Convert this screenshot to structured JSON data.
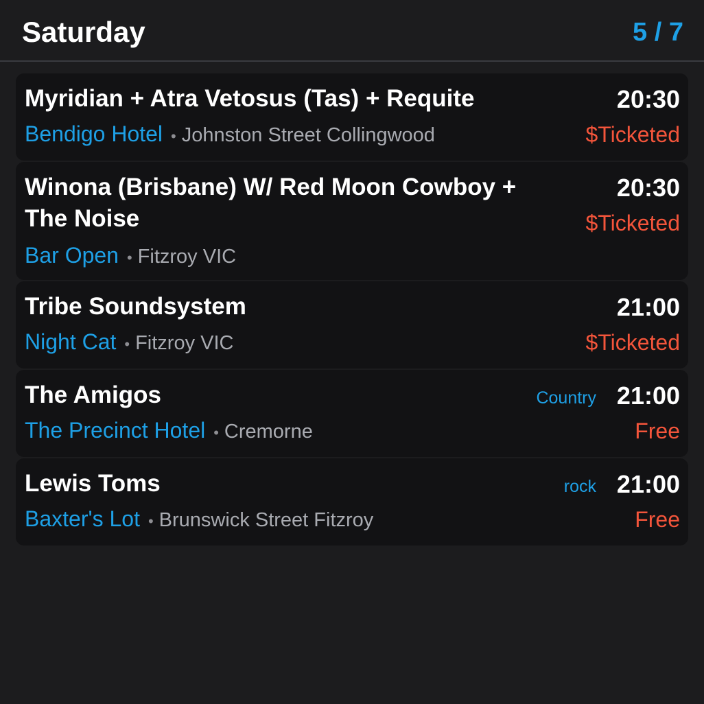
{
  "header": {
    "title": "Saturday",
    "page_indicator": "5 / 7"
  },
  "events": [
    {
      "title": "Myridian + Atra Vetosus (Tas) + Requite",
      "venue": "Bendigo Hotel",
      "separator": "•",
      "location": "Johnston Street Collingwood",
      "time": "20:30",
      "price": "$Ticketed",
      "genre": ""
    },
    {
      "title": "Winona (Brisbane) W/ Red Moon Cowboy + The Noise",
      "venue": "Bar Open",
      "separator": "•",
      "location": "Fitzroy VIC",
      "time": "20:30",
      "price": "$Ticketed",
      "genre": ""
    },
    {
      "title": "Tribe Soundsystem",
      "venue": "Night Cat",
      "separator": "•",
      "location": "Fitzroy VIC",
      "time": "21:00",
      "price": "$Ticketed",
      "genre": ""
    },
    {
      "title": "The Amigos",
      "venue": "The Precinct Hotel",
      "separator": "•",
      "location": "Cremorne",
      "time": "21:00",
      "price": "Free",
      "genre": "Country"
    },
    {
      "title": "Lewis Toms",
      "venue": "Baxter's Lot",
      "separator": "•",
      "location": "Brunswick Street Fitzroy",
      "time": "21:00",
      "price": "Free",
      "genre": "rock"
    }
  ],
  "colors": {
    "background": "#1c1c1e",
    "card": "#121214",
    "accent": "#1ea0e6",
    "price": "#f4553b",
    "location": "#a9abb1"
  }
}
